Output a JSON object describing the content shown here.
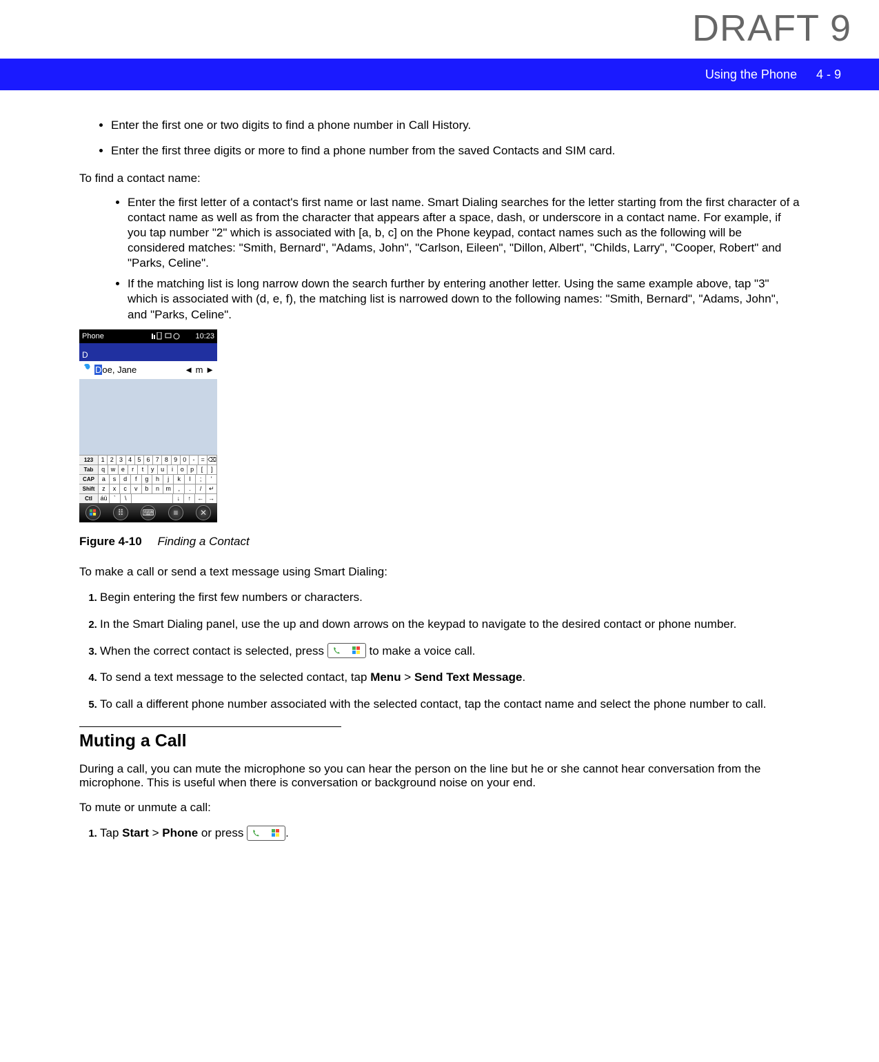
{
  "watermark": "DRAFT 9",
  "header": {
    "chapter": "Using the Phone",
    "page_ref": "4 - 9"
  },
  "intro_bullets": [
    "Enter the first one or two digits to find a phone number in Call History.",
    "Enter the first three digits or more to find a phone number from the saved Contacts and SIM card."
  ],
  "find_name_intro": "To find a contact name:",
  "find_name_bullets": [
    "Enter the first letter of a contact's first name or last name. Smart Dialing searches for the letter starting from the first character of a contact name as well as from the character that appears after a space, dash, or underscore in a contact name. For example, if you tap number \"2\" which is associated with [a, b, c] on the Phone keypad, contact names such as the following will be considered matches: \"Smith, Bernard\", \"Adams, John\", \"Carlson, Eileen\", \"Dillon, Albert\", \"Childs, Larry\", \"Cooper, Robert\" and \"Parks, Celine\".",
    "If the matching list is long narrow down the search further by entering another letter. Using the same example above, tap \"3\" which is associated with (d, e, f), the matching list is narrowed down to the following names: \"Smith, Bernard\", \"Adams, John\", and \"Parks, Celine\"."
  ],
  "screenshot": {
    "title": "Phone",
    "time": "10:23",
    "search_prefix": "D",
    "contact_highlight": "D",
    "contact_rest": "oe, Jane",
    "side_label": "m",
    "kb_rows": [
      {
        "label": "123",
        "keys": [
          "1",
          "2",
          "3",
          "4",
          "5",
          "6",
          "7",
          "8",
          "9",
          "0",
          "-",
          "=",
          "⌫"
        ]
      },
      {
        "label": "Tab",
        "keys": [
          "q",
          "w",
          "e",
          "r",
          "t",
          "y",
          "u",
          "i",
          "o",
          "p",
          "[",
          "]"
        ]
      },
      {
        "label": "CAP",
        "keys": [
          "a",
          "s",
          "d",
          "f",
          "g",
          "h",
          "j",
          "k",
          "l",
          ";",
          "'"
        ]
      },
      {
        "label": "Shift",
        "keys": [
          "z",
          "x",
          "c",
          "v",
          "b",
          "n",
          "m",
          ",",
          ".",
          "/",
          "↵"
        ]
      },
      {
        "label": "Ctl",
        "keys": [
          "áü",
          "`",
          "\\",
          " ",
          " ",
          "↓",
          "↑",
          "←",
          "→"
        ]
      }
    ]
  },
  "figure": {
    "label": "Figure 4-10",
    "caption": "Finding a Contact"
  },
  "smart_dialing_intro": "To make a call or send a text message using Smart Dialing:",
  "steps": [
    "Begin entering the first few numbers or characters.",
    "In the Smart Dialing panel, use the up and down arrows on the keypad to navigate to the desired contact or phone number.",
    {
      "pre": "When the correct contact is selected, press ",
      "post": " to make a voice call."
    },
    {
      "pre": "To send a text message to the selected contact, tap ",
      "b1": "Menu",
      "mid": " > ",
      "b2": "Send Text Message",
      "post": "."
    },
    "To call a different phone number associated with the selected contact, tap the contact name and select the phone number to call."
  ],
  "muting": {
    "heading": "Muting a Call",
    "para": "During a call, you can mute the microphone so you can hear the person on the line but he or she cannot hear conversation from the microphone. This is useful when there is conversation or background noise on your end.",
    "intro": "To mute or unmute a call:",
    "step1": {
      "pre": "Tap ",
      "b1": "Start",
      "mid1": " > ",
      "b2": "Phone",
      "mid2": " or press ",
      "post": "."
    }
  }
}
